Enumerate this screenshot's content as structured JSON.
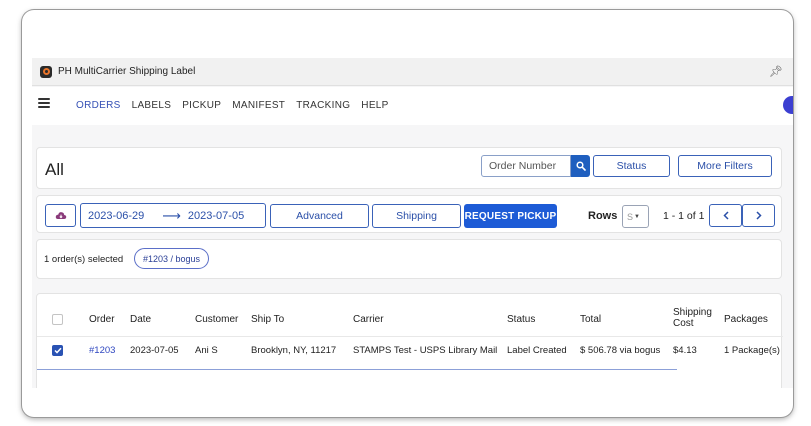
{
  "app": {
    "title": "PH MultiCarrier Shipping Label"
  },
  "nav": {
    "items": [
      {
        "label": "ORDERS",
        "active": true
      },
      {
        "label": "LABELS",
        "active": false
      },
      {
        "label": "PICKUP",
        "active": false
      },
      {
        "label": "MANIFEST",
        "active": false
      },
      {
        "label": "TRACKING",
        "active": false
      },
      {
        "label": "HELP",
        "active": false
      }
    ]
  },
  "filters": {
    "page_title": "All",
    "order_number_placeholder": "Order Number",
    "status_label": "Status",
    "more_filters_label": "More Filters"
  },
  "toolbar": {
    "date_from": "2023-06-29",
    "date_to": "2023-07-05",
    "advanced_label": "Advanced",
    "shipping_label": "Shipping",
    "request_pickup_label": "REQUEST PICKUP",
    "rows_label": "Rows",
    "rows_value": "S",
    "pagination_text": "1 - 1 of 1"
  },
  "selection": {
    "text": "1 order(s) selected",
    "chip_label": "#1203 / bogus"
  },
  "table": {
    "headers": [
      "Order",
      "Date",
      "Customer",
      "Ship To",
      "Carrier",
      "Status",
      "Total",
      "Shipping Cost",
      "Packages"
    ],
    "shipping_cost_line1": "Shipping",
    "shipping_cost_line2": "Cost",
    "rows": [
      {
        "order": "#1203",
        "date": "2023-07-05",
        "customer": "Ani S",
        "ship_to": "Brooklyn, NY, 11217",
        "carrier": "STAMPS Test - USPS Library Mail",
        "status": "Label Created",
        "total": "$ 506.78 via bogus",
        "shipping_cost": "$4.13",
        "packages": "1 Package(s)",
        "selected": true
      }
    ]
  },
  "colors": {
    "accent": "#1d5bd6",
    "link": "#2f47c0",
    "nav_active": "#3550b5"
  }
}
